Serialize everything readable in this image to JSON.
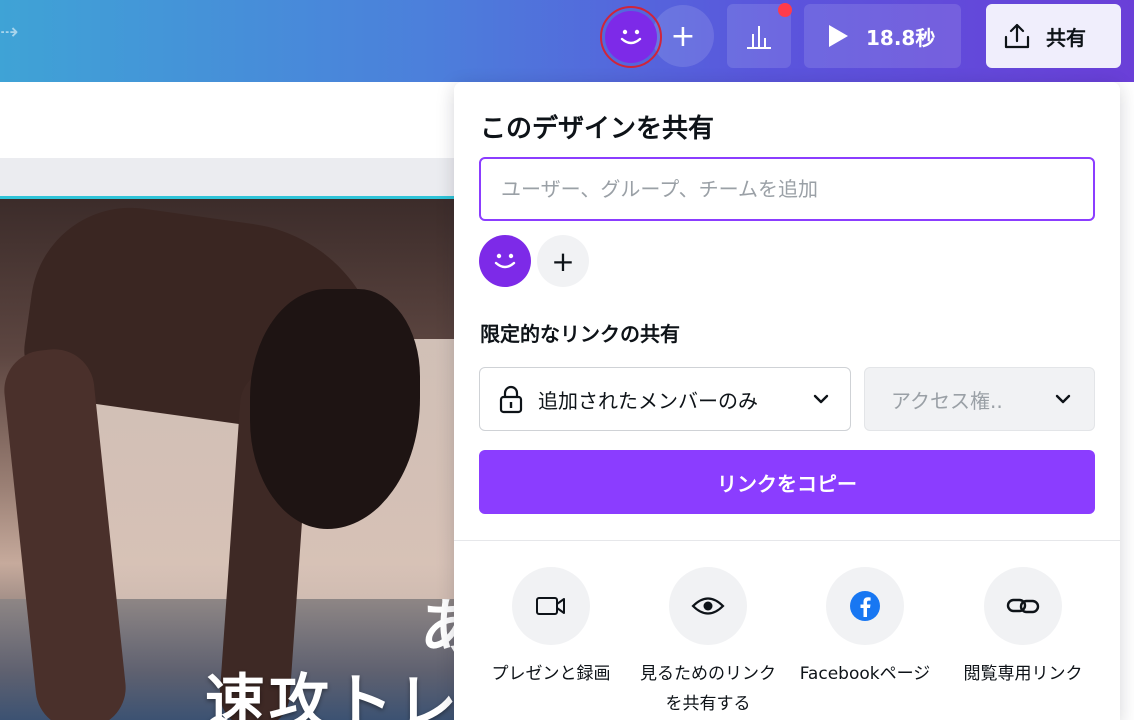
{
  "topbar": {
    "duration": "18.8秒",
    "share_label": "共有",
    "colors": {
      "gradient_start": "#3fa3d6",
      "gradient_end": "#6a3fd8",
      "notification_dot": "#ff3b4a"
    }
  },
  "canvas": {
    "overlay_text_line1": "あ",
    "overlay_text_line2": "速攻トレ"
  },
  "share_panel": {
    "title": "このデザインを共有",
    "add_people_placeholder": "ユーザー、グループ、チームを追加",
    "restricted_link_label": "限定的なリンクの共有",
    "access_scope": "追加されたメンバーのみ",
    "access_permission": "アクセス権..",
    "copy_link_label": "リンクをコピー",
    "accent_color": "#8b3dff",
    "options": [
      {
        "icon": "video-camera-icon",
        "label": "プレゼンと録画"
      },
      {
        "icon": "eye-icon",
        "label": "見るためのリンクを共有する"
      },
      {
        "icon": "facebook-icon",
        "label": "Facebookページ"
      },
      {
        "icon": "link-icon",
        "label": "閲覧専用リンク"
      }
    ]
  }
}
